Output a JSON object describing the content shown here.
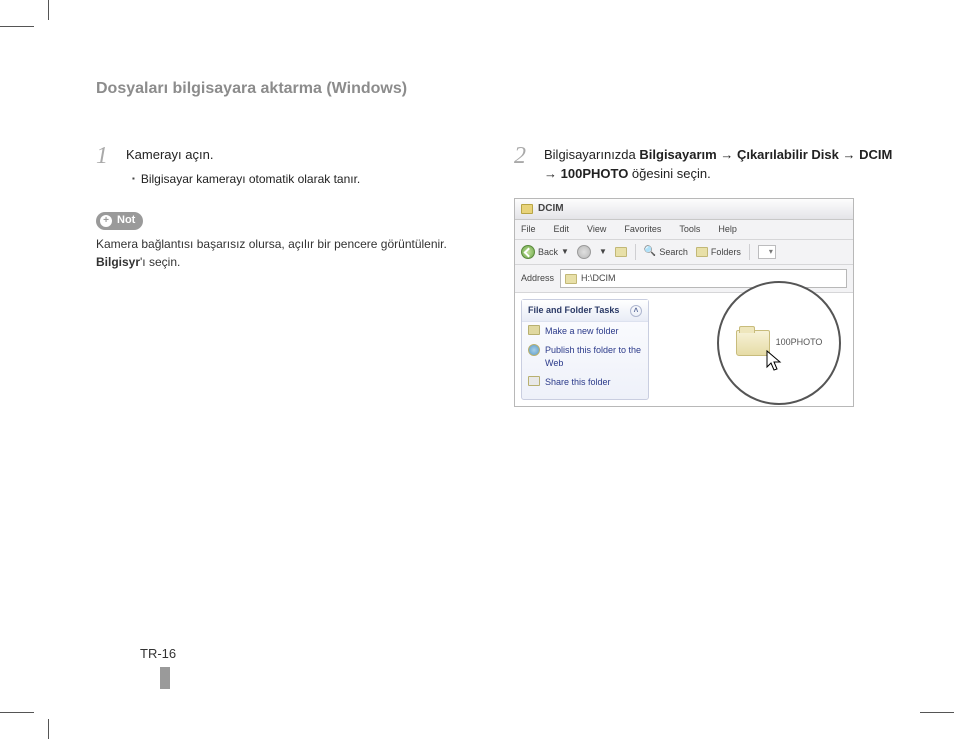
{
  "title": "Dosyaları bilgisayara aktarma (Windows)",
  "step1": {
    "num": "1",
    "text": "Kamerayı açın.",
    "sub": "Bilgisayar kamerayı otomatik olarak tanır."
  },
  "note": {
    "badge": "Not",
    "text_pre": "Kamera bağlantısı başarısız olursa, açılır bir pencere görüntülenir. ",
    "text_bold": "Bilgisyr",
    "text_post": "'ı seçin."
  },
  "step2": {
    "num": "2",
    "pre": "Bilgisayarınızda ",
    "b1": "Bilgisayarım",
    "arrow": " → ",
    "b2": "Çıkarılabilir Disk",
    "b3": "DCIM",
    "b4": "100PHOTO",
    "post": " öğesini seçin."
  },
  "explorer": {
    "title": "DCIM",
    "menu": {
      "file": "File",
      "edit": "Edit",
      "view": "View",
      "favorites": "Favorites",
      "tools": "Tools",
      "help": "Help"
    },
    "toolbar": {
      "back": "Back",
      "search": "Search",
      "folders": "Folders"
    },
    "address_label": "Address",
    "address_value": "H:\\DCIM",
    "tasks_header": "File and Folder Tasks",
    "task1": "Make a new folder",
    "task2": "Publish this folder to the Web",
    "task3": "Share this folder",
    "zoom_label": "100PHOTO"
  },
  "page_num": "TR-16"
}
